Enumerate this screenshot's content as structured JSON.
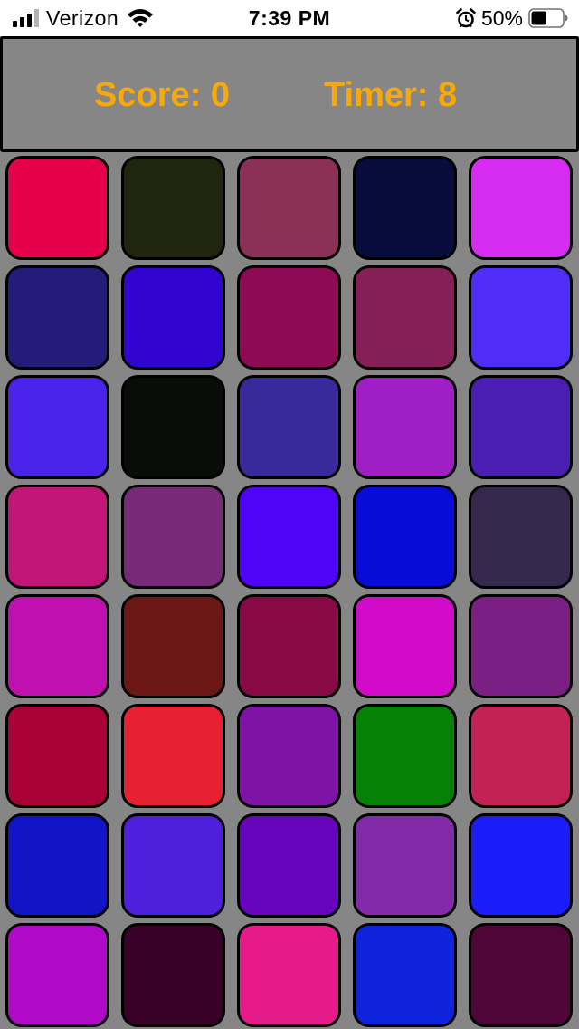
{
  "status_bar": {
    "carrier": "Verizon",
    "time": "7:39 PM",
    "battery_percent": "50%",
    "battery_level": 0.5,
    "signal_bars": 4,
    "signal_bars_active": 3,
    "icons": [
      "signal-icon",
      "wifi-icon",
      "alarm-icon",
      "battery-icon"
    ]
  },
  "header": {
    "score_text": "Score: 0",
    "timer_text": "Timer: 8",
    "label_color": "#f7a80b"
  },
  "grid": {
    "columns": 5,
    "rows": 8,
    "tiles": [
      "#e6004c",
      "#202510",
      "#8c3058",
      "#080c3c",
      "#d62bf0",
      "#231d79",
      "#3204d0",
      "#8f0a54",
      "#861f57",
      "#4f2cf7",
      "#4b23e8",
      "#080d08",
      "#392a9c",
      "#a01fc4",
      "#481fb1",
      "#c11677",
      "#782a79",
      "#4f03f7",
      "#070cd9",
      "#34294d",
      "#c110b0",
      "#6d1616",
      "#880a44",
      "#d20bc9",
      "#7c1f84",
      "#a80237",
      "#e62232",
      "#7e13a5",
      "#058205",
      "#c32354",
      "#1313c7",
      "#4e20db",
      "#6603bd",
      "#822aa8",
      "#1a1df8",
      "#b00ac8",
      "#380126",
      "#e61b8a",
      "#0e23db",
      "#500539"
    ]
  }
}
